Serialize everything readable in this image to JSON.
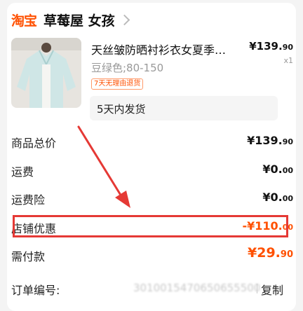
{
  "shop": {
    "platform_logo": "淘宝",
    "name": "草莓屋 女孩"
  },
  "product": {
    "title": "天丝皱防晒衬衫衣女夏季薄…",
    "price_int": "¥139.",
    "price_dec": "90",
    "quantity": "x1",
    "variant": "豆绿色;80-150",
    "tag": "7天无理由退货",
    "shipping": "5天内发货"
  },
  "summary": {
    "total_label": "商品总价",
    "total_int": "¥139.",
    "total_dec": "90",
    "freight_label": "运费",
    "freight_int": "¥0.",
    "freight_dec": "00",
    "insurance_label": "运费险",
    "insurance_int": "¥0.",
    "insurance_dec": "00",
    "discount_label": "店铺优惠",
    "discount_int": "-¥110.",
    "discount_dec": "00",
    "pay_label": "需付款",
    "pay_int": "¥29.",
    "pay_dec": "90"
  },
  "order": {
    "label": "订单编号:",
    "number": "3010015470650655500",
    "copy_label": "复制"
  },
  "colors": {
    "accent": "#ff5000",
    "highlight_box": "#e53935",
    "arrow": "#e53935"
  },
  "icons": {
    "shop_chevron": "chevron-right-icon"
  }
}
